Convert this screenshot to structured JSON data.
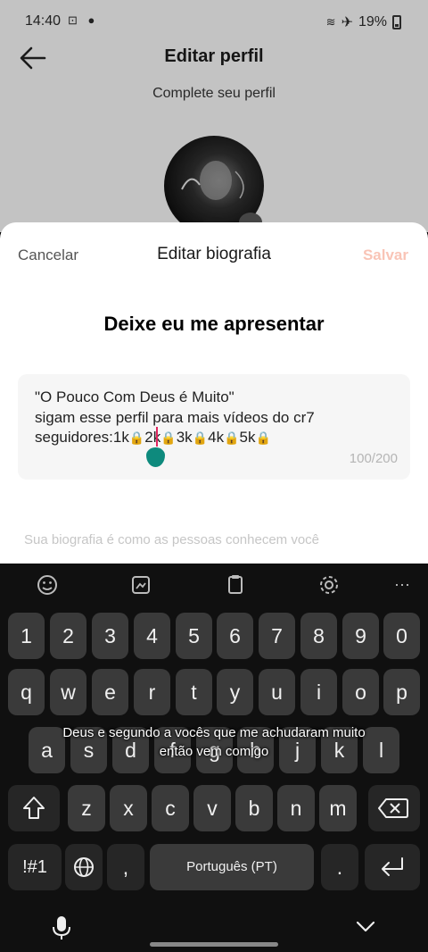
{
  "status_bar": {
    "time": "14:40",
    "battery": "19%"
  },
  "header": {
    "title": "Editar perfil"
  },
  "profile": {
    "complete_text": "Complete seu perfil"
  },
  "sheet": {
    "cancel_label": "Cancelar",
    "title": "Editar biografia",
    "save_label": "Salvar",
    "headline": "Deixe eu me apresentar",
    "bio": {
      "line1": "\"O Pouco Com Deus é Muito\"",
      "line2": "sigam esse perfil para mais vídeos do cr7",
      "line3_prefix": "seguidores:",
      "milestones": [
        "1k",
        "2k",
        "3k",
        "4k",
        "5k"
      ],
      "counter": "100/200"
    },
    "hint": "Sua biografia é como as pessoas conhecem você"
  },
  "keyboard": {
    "row_numbers": [
      "1",
      "2",
      "3",
      "4",
      "5",
      "6",
      "7",
      "8",
      "9",
      "0"
    ],
    "row1": [
      "q",
      "w",
      "e",
      "r",
      "t",
      "y",
      "u",
      "i",
      "o",
      "p"
    ],
    "row2": [
      "a",
      "s",
      "d",
      "f",
      "g",
      "h",
      "j",
      "k",
      "l"
    ],
    "row3": [
      "z",
      "x",
      "c",
      "v",
      "b",
      "n",
      "m"
    ],
    "symbols_label": "!#1",
    "comma_label": ",",
    "space_label": "Português (PT)",
    "period_label": "."
  },
  "caption": {
    "line1": "Deus e segundo a vocês que me achudaram muito",
    "line2": "então vem comigo"
  }
}
